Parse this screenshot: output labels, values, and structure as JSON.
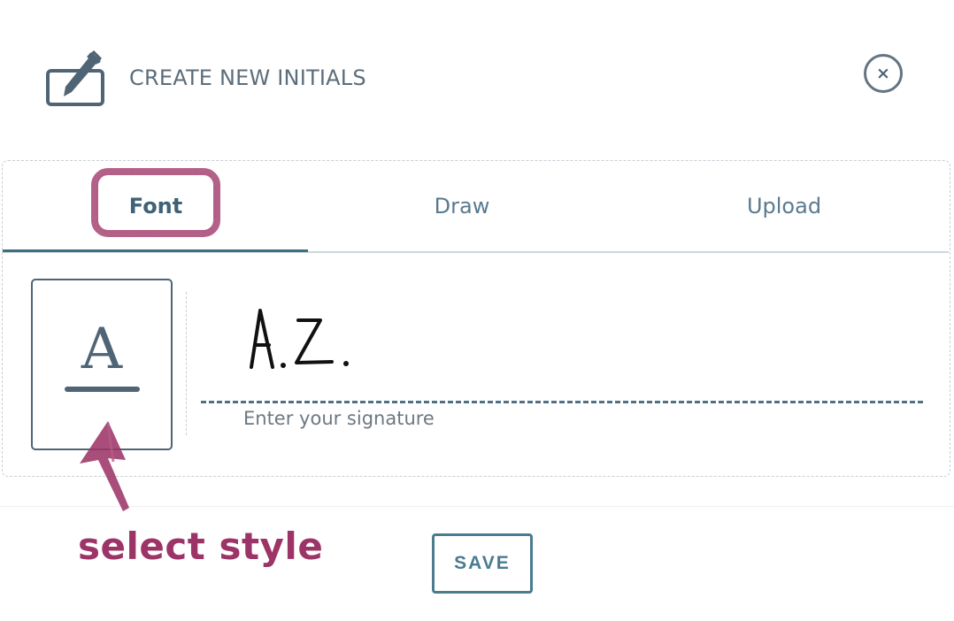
{
  "header": {
    "title": "CREATE NEW INITIALS",
    "close_label": "×"
  },
  "tabs": [
    {
      "label": "Font",
      "active": true
    },
    {
      "label": "Draw",
      "active": false
    },
    {
      "label": "Upload",
      "active": false
    }
  ],
  "font_panel": {
    "style_button_letter": "A",
    "signature_value": "A.Z.",
    "signature_placeholder": "Enter your signature"
  },
  "footer": {
    "save_label": "SAVE"
  },
  "annotation": {
    "text": "select style",
    "color": "#9d3468"
  },
  "colors": {
    "primary": "#4a7b91",
    "text": "#4f6475",
    "annotation": "#9d3468"
  }
}
